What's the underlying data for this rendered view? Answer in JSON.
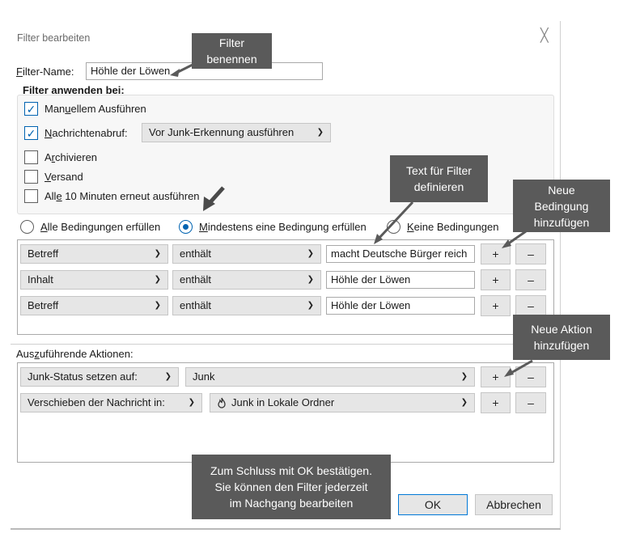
{
  "dialog": {
    "title": "Filter bearbeiten",
    "close_glyph": "╳"
  },
  "filter_name": {
    "label_key": "F",
    "label_rest": "ilter-Name:",
    "value": "Höhle der Löwen"
  },
  "apply": {
    "heading": "Filter anwenden bei:",
    "options": [
      {
        "pre": "Man",
        "key": "u",
        "post": "ellem Ausführen",
        "checked": true
      },
      {
        "pre": "",
        "key": "N",
        "post": "achrichtenabruf:",
        "checked": true
      },
      {
        "pre": "A",
        "key": "r",
        "post": "chivieren",
        "checked": false
      },
      {
        "pre": "",
        "key": "V",
        "post": "ersand",
        "checked": false
      },
      {
        "pre": "All",
        "key": "e",
        "post": " 10 Minuten erneut ausführen",
        "checked": false
      }
    ],
    "fetch_select": "Vor Junk-Erkennung ausführen"
  },
  "match": {
    "options": [
      {
        "key": "A",
        "post": "lle Bedingungen erfüllen",
        "selected": false
      },
      {
        "key": "M",
        "post": "indestens eine Bedingung erfüllen",
        "selected": true
      },
      {
        "key": "K",
        "post": "eine Bedingungen",
        "selected": false
      }
    ]
  },
  "conditions": [
    {
      "field": "Betreff",
      "operator": "enthält",
      "value": "macht Deutsche Bürger reich"
    },
    {
      "field": "Inhalt",
      "operator": "enthält",
      "value": "Höhle der Löwen"
    },
    {
      "field": "Betreff",
      "operator": "enthält",
      "value": "Höhle der Löwen"
    }
  ],
  "actions_section": {
    "label_pre": "Aus",
    "label_key": "z",
    "label_post": "uführende Aktionen:"
  },
  "actions": [
    {
      "type": "Junk-Status setzen auf:",
      "target": "Junk",
      "target_icon": "junk-flame-icon"
    },
    {
      "type": "Verschieben der Nachricht in:",
      "target": "Junk in Lokale Ordner",
      "target_icon": "folder-junk-icon"
    }
  ],
  "row_buttons": {
    "add": "+",
    "remove": "–"
  },
  "footer": {
    "ok": "OK",
    "cancel": "Abbrechen"
  },
  "callouts": {
    "name": "Filter\nbenennen",
    "text": "Text für Filter\ndefinieren",
    "condition": "Neue\nBedingung\nhinzufügen",
    "action": "Neue Aktion\nhinzufügen",
    "confirm": "Zum Schluss mit OK bestätigen.\nSie können den Filter jederzeit\nim Nachgang bearbeiten"
  },
  "colors": {
    "accent": "#0063b1",
    "callout_bg": "#5a5a5a",
    "control_bg": "#e6e6e6"
  }
}
